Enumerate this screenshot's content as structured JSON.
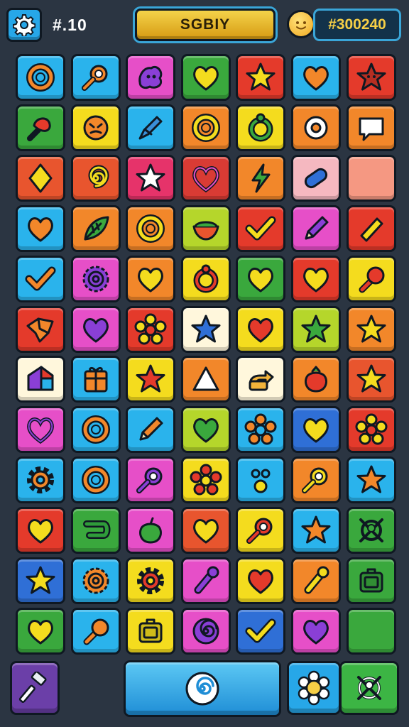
{
  "header": {
    "moves_text": "#.10",
    "title_text": "SGBIY",
    "score_text": "#300240",
    "gear_icon": "gear-icon",
    "coin_icon": "coin-icon",
    "colors": {
      "accent": "#3aa6d8",
      "title_plate": "#e9b52c",
      "score_text": "#f6cf46"
    }
  },
  "board": {
    "columns": 7,
    "rows": 12,
    "rows_data": [
      [
        {
          "color": "#2ab3ec",
          "icon": "ring"
        },
        {
          "color": "#2ab3ec",
          "icon": "magnifier"
        },
        {
          "color": "#e64fc8",
          "icon": "blob"
        },
        {
          "color": "#3aa83d",
          "icon": "heart"
        },
        {
          "color": "#e43a2b",
          "icon": "star"
        },
        {
          "color": "#2ab3ec",
          "icon": "heart"
        },
        {
          "color": "#e43a2b",
          "icon": "star-face"
        }
      ],
      [
        {
          "color": "#3aa83d",
          "icon": "pin"
        },
        {
          "color": "#f4dc1e",
          "icon": "face"
        },
        {
          "color": "#2ab3ec",
          "icon": "pen"
        },
        {
          "color": "#f2872a",
          "icon": "ring"
        },
        {
          "color": "#f4dc1e",
          "icon": "ring-bud"
        },
        {
          "color": "#f2872a",
          "icon": "donut"
        },
        {
          "color": "#f2872a",
          "icon": "speech"
        }
      ],
      [
        {
          "color": "#e8552e",
          "icon": "diamond"
        },
        {
          "color": "#e8552e",
          "icon": "spiral"
        },
        {
          "color": "#e6336a",
          "icon": "star"
        },
        {
          "color": "#d93b34",
          "icon": "heart-outline"
        },
        {
          "color": "#f2872a",
          "icon": "bolt"
        },
        {
          "color": "#f5b8c0",
          "icon": "pill"
        },
        {
          "color": "#f59882",
          "icon": "blank"
        }
      ],
      [
        {
          "color": "#2ab3ec",
          "icon": "heart"
        },
        {
          "color": "#f2872a",
          "icon": "leaf"
        },
        {
          "color": "#f2872a",
          "icon": "ring"
        },
        {
          "color": "#b5d62b",
          "icon": "bowl"
        },
        {
          "color": "#e43a2b",
          "icon": "check"
        },
        {
          "color": "#e64fc8",
          "icon": "pencil"
        },
        {
          "color": "#e43a2b",
          "icon": "bar"
        }
      ],
      [
        {
          "color": "#2ab3ec",
          "icon": "check"
        },
        {
          "color": "#e64fc8",
          "icon": "sun"
        },
        {
          "color": "#f2872a",
          "icon": "heart"
        },
        {
          "color": "#f4dc1e",
          "icon": "donut-bud"
        },
        {
          "color": "#3aa83d",
          "icon": "heart"
        },
        {
          "color": "#e43a2b",
          "icon": "heart"
        },
        {
          "color": "#f4dc1e",
          "icon": "lollipop"
        }
      ],
      [
        {
          "color": "#e43a2b",
          "icon": "shard"
        },
        {
          "color": "#e64fc8",
          "icon": "heart"
        },
        {
          "color": "#e43a2b",
          "icon": "flower"
        },
        {
          "color": "#fff7dc",
          "icon": "star"
        },
        {
          "color": "#f4dc1e",
          "icon": "heart"
        },
        {
          "color": "#b5d62b",
          "icon": "star"
        },
        {
          "color": "#f2872a",
          "icon": "star"
        }
      ],
      [
        {
          "color": "#fff7dc",
          "icon": "house"
        },
        {
          "color": "#2ab3ec",
          "icon": "gift"
        },
        {
          "color": "#f4dc1e",
          "icon": "star"
        },
        {
          "color": "#f2872a",
          "icon": "triangle"
        },
        {
          "color": "#fff7dc",
          "icon": "arrow-box"
        },
        {
          "color": "#f2872a",
          "icon": "berry"
        },
        {
          "color": "#e8552e",
          "icon": "star"
        }
      ],
      [
        {
          "color": "#e64fc8",
          "icon": "heart-outline"
        },
        {
          "color": "#2ab3ec",
          "icon": "ring"
        },
        {
          "color": "#2ab3ec",
          "icon": "pencil"
        },
        {
          "color": "#b5d62b",
          "icon": "heart"
        },
        {
          "color": "#2ab3ec",
          "icon": "flower"
        },
        {
          "color": "#2f6fd6",
          "icon": "heart"
        },
        {
          "color": "#e43a2b",
          "icon": "flower"
        }
      ],
      [
        {
          "color": "#2ab3ec",
          "icon": "gear"
        },
        {
          "color": "#2ab3ec",
          "icon": "ring"
        },
        {
          "color": "#e64fc8",
          "icon": "magnifier"
        },
        {
          "color": "#f4dc1e",
          "icon": "flower"
        },
        {
          "color": "#2ab3ec",
          "icon": "dots"
        },
        {
          "color": "#f2872a",
          "icon": "magnifier"
        },
        {
          "color": "#2ab3ec",
          "icon": "star"
        }
      ],
      [
        {
          "color": "#e43a2b",
          "icon": "heart"
        },
        {
          "color": "#3aa83d",
          "icon": "hook"
        },
        {
          "color": "#e64fc8",
          "icon": "apple"
        },
        {
          "color": "#e8552e",
          "icon": "heart"
        },
        {
          "color": "#f4dc1e",
          "icon": "magnifier"
        },
        {
          "color": "#2ab3ec",
          "icon": "star"
        },
        {
          "color": "#3aa83d",
          "icon": "target"
        }
      ],
      [
        {
          "color": "#2f6fd6",
          "icon": "star"
        },
        {
          "color": "#2ab3ec",
          "icon": "sun"
        },
        {
          "color": "#f4dc1e",
          "icon": "gear"
        },
        {
          "color": "#e64fc8",
          "icon": "bone"
        },
        {
          "color": "#f4dc1e",
          "icon": "heart"
        },
        {
          "color": "#f2872a",
          "icon": "bone"
        },
        {
          "color": "#3aa83d",
          "icon": "box"
        }
      ],
      [
        {
          "color": "#3aa83d",
          "icon": "heart"
        },
        {
          "color": "#2ab3ec",
          "icon": "lollipop"
        },
        {
          "color": "#f4dc1e",
          "icon": "box"
        },
        {
          "color": "#e64fc8",
          "icon": "swirl"
        },
        {
          "color": "#2f6fd6",
          "icon": "check"
        },
        {
          "color": "#e64fc8",
          "icon": "heart"
        },
        {
          "color": "#3aa83d",
          "icon": "blank"
        }
      ]
    ]
  },
  "bottom_bar": {
    "tool_icon": "hammer-icon",
    "main_icon": "spiral-icon",
    "flower_icon": "flower-icon",
    "target_icon": "target-icon",
    "colors": {
      "tool": "#6b3fa8",
      "main": "#27a7e8",
      "flower": "#27a7e8",
      "target": "#3cb544"
    }
  }
}
